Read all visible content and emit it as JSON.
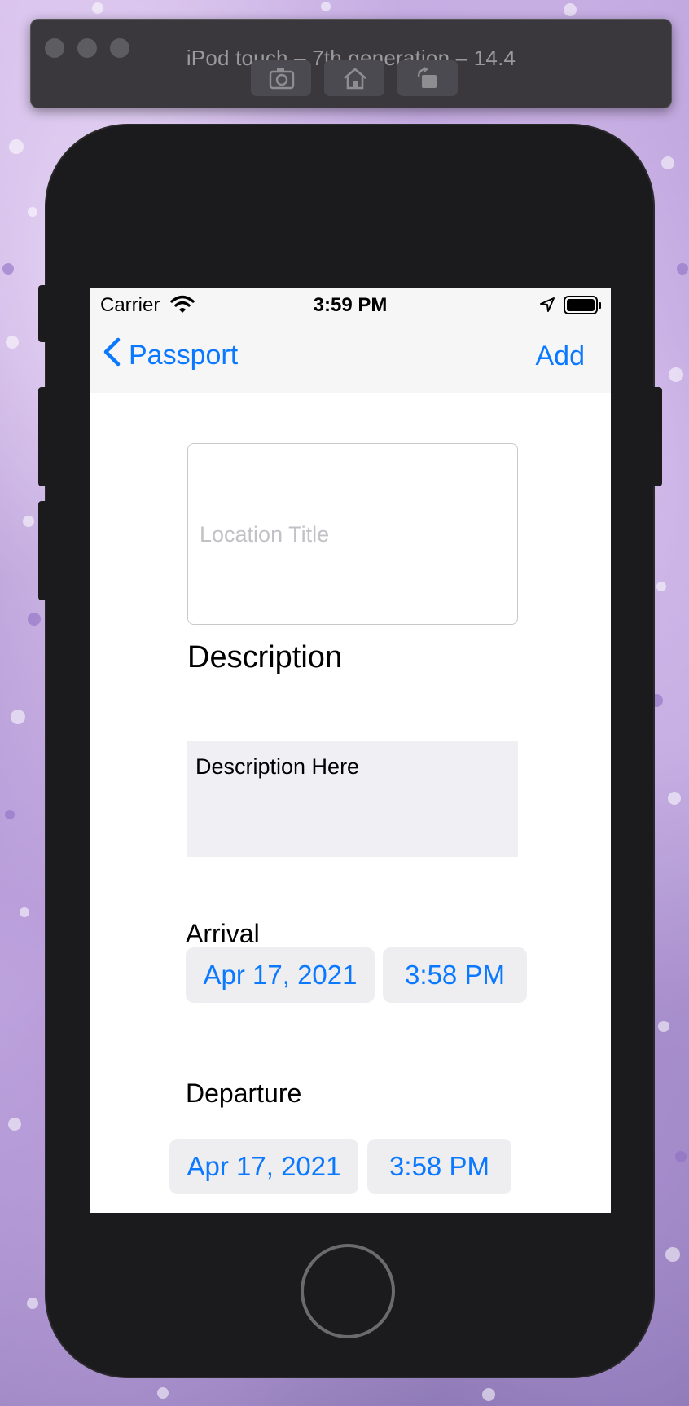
{
  "simulator": {
    "title": "iPod touch – 7th generation – 14.4",
    "buttons": [
      "screenshot-icon",
      "home-icon",
      "rotate-icon"
    ]
  },
  "status_bar": {
    "carrier": "Carrier",
    "time": "3:59 PM"
  },
  "nav": {
    "back_label": "Passport",
    "add_label": "Add"
  },
  "form": {
    "title_placeholder": "Location Title",
    "description_heading": "Description",
    "description_text": "Description Here",
    "arrival_label": "Arrival",
    "arrival_date": "Apr 17, 2021",
    "arrival_time": "3:58 PM",
    "departure_label": "Departure",
    "departure_date": "Apr 17, 2021",
    "departure_time": "3:58 PM"
  },
  "colors": {
    "accent": "#0a78ff",
    "field_bg": "#efeff4",
    "pill_bg": "#eeeef0"
  }
}
